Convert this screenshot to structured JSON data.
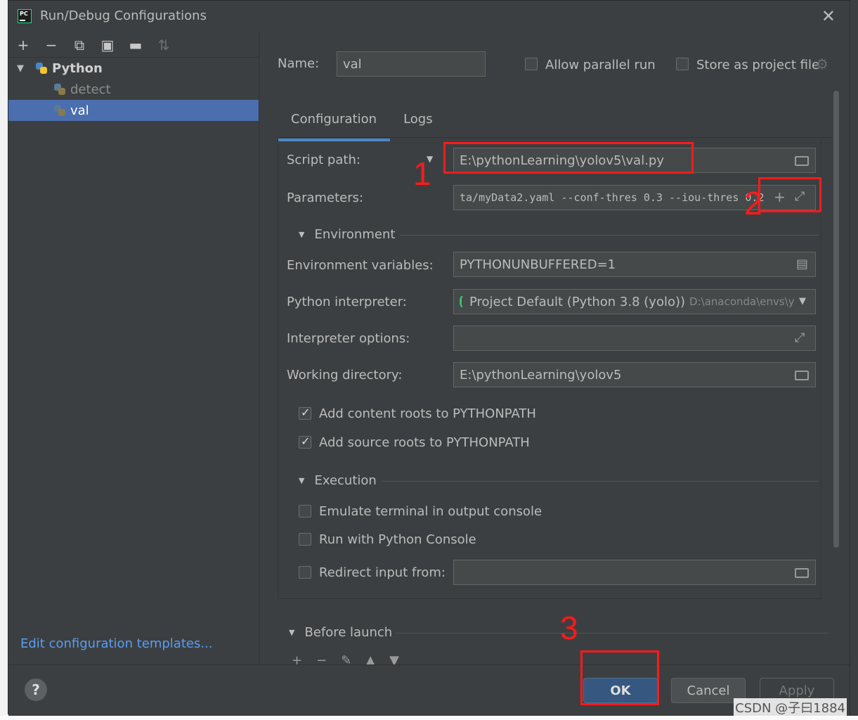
{
  "window": {
    "title": "Run/Debug Configurations",
    "app_icon_text": "PC"
  },
  "sidebar": {
    "toolbar": [
      "plus-icon",
      "minus-icon",
      "copy-icon",
      "save-icon",
      "new-folder-icon",
      "sort-icon"
    ],
    "root_label": "Python",
    "items": [
      {
        "label": "detect",
        "selected": false
      },
      {
        "label": "val",
        "selected": true
      }
    ],
    "edit_templates_link": "Edit configuration templates..."
  },
  "header": {
    "name_label": "Name:",
    "name_value": "val",
    "allow_parallel_label": "Allow parallel run",
    "allow_parallel_checked": false,
    "store_project_label": "Store as project file",
    "store_project_checked": false
  },
  "tabs": [
    {
      "label": "Configuration",
      "active": true
    },
    {
      "label": "Logs",
      "active": false
    }
  ],
  "config": {
    "script_path_label": "Script path:",
    "script_path_value": "E:\\pythonLearning\\yolov5\\val.py",
    "parameters_label": "Parameters:",
    "parameters_value": "ta/myData2.yaml --conf-thres 0.3 --iou-thres 0.2",
    "environment_section": "Environment",
    "env_vars_label": "Environment variables:",
    "env_vars_value": "PYTHONUNBUFFERED=1",
    "interpreter_label": "Python interpreter:",
    "interpreter_value": "Project Default (Python 3.8 (yolo))",
    "interpreter_path": "D:\\anaconda\\envs\\y",
    "interpreter_options_label": "Interpreter options:",
    "interpreter_options_value": "",
    "working_dir_label": "Working directory:",
    "working_dir_value": "E:\\pythonLearning\\yolov5",
    "add_content_roots_label": "Add content roots to PYTHONPATH",
    "add_content_roots_checked": true,
    "add_source_roots_label": "Add source roots to PYTHONPATH",
    "add_source_roots_checked": true,
    "execution_section": "Execution",
    "emulate_terminal_label": "Emulate terminal in output console",
    "emulate_terminal_checked": false,
    "run_python_console_label": "Run with Python Console",
    "run_python_console_checked": false,
    "redirect_input_label": "Redirect input from:",
    "redirect_input_checked": false,
    "redirect_input_value": "",
    "before_launch_section": "Before launch"
  },
  "footer": {
    "help_label": "?",
    "ok_label": "OK",
    "cancel_label": "Cancel",
    "apply_label": "Apply"
  },
  "annotations": {
    "marker_1": "1",
    "marker_2": "2",
    "marker_3": "3",
    "color": "#ff1a1a"
  },
  "watermark": "CSDN @子曰1884",
  "colors": {
    "dialog_bg": "#3c3f41",
    "selection": "#4b6eaf",
    "link": "#589df6",
    "ok_button": "#365880",
    "tab_underline": "#4a88c7"
  }
}
